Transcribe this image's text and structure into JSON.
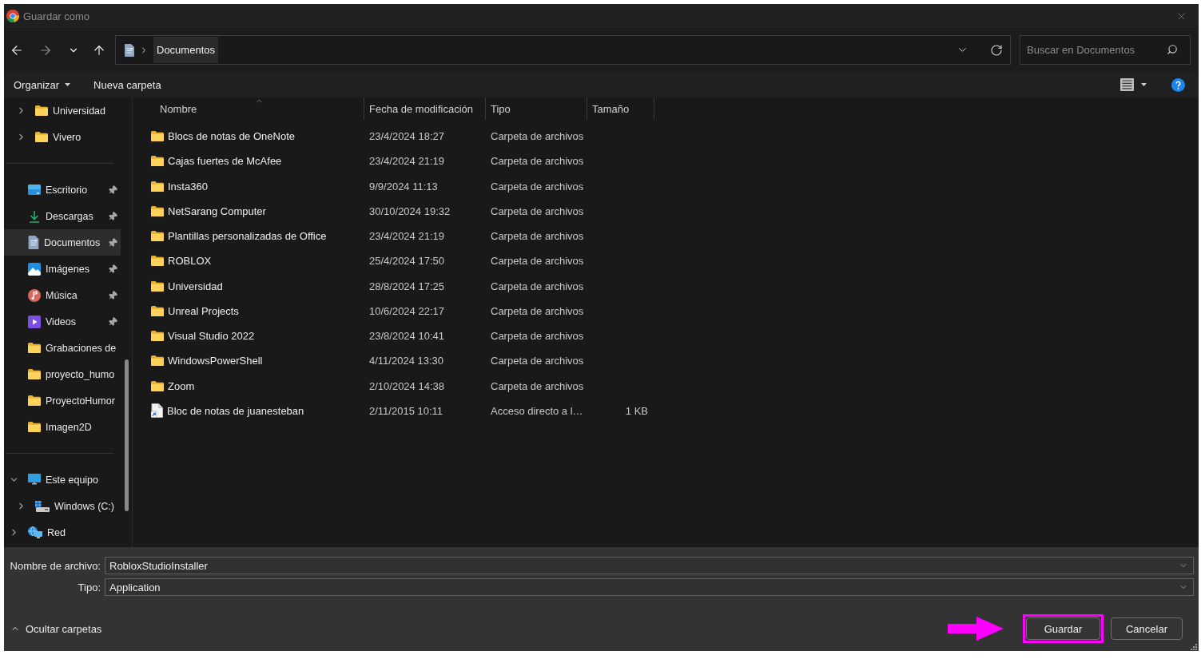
{
  "window": {
    "title": "Guardar como"
  },
  "navigation": {
    "buttons": [
      {
        "kind": "back",
        "disabled": false
      },
      {
        "kind": "forward",
        "disabled": true
      },
      {
        "kind": "recent",
        "disabled": false
      },
      {
        "kind": "up",
        "disabled": false
      }
    ],
    "address": {
      "path": [
        "Documentos"
      ]
    },
    "search": {
      "placeholder": "Buscar en Documentos"
    }
  },
  "toolbar": {
    "items": [
      {
        "label": "Organizar",
        "kind": "menu"
      },
      {
        "label": "Nueva carpeta",
        "kind": "button"
      }
    ]
  },
  "sidebar": {
    "sections": [
      {
        "kind": "nested",
        "items": [
          {
            "label": "Universidad",
            "kind": "folder",
            "expanded": false,
            "selected": false
          },
          {
            "label": "Vivero",
            "kind": "folder",
            "expanded": false,
            "selected": false
          }
        ]
      },
      {
        "kind": "quick_access",
        "items": [
          {
            "label": "Escritorio",
            "kind": "desktop",
            "pinned": true,
            "selected": false
          },
          {
            "label": "Descargas",
            "kind": "download",
            "pinned": true,
            "selected": false
          },
          {
            "label": "Documentos",
            "kind": "documents",
            "pinned": true,
            "selected": true
          },
          {
            "label": "Imágenes",
            "kind": "pictures",
            "pinned": true,
            "selected": false
          },
          {
            "label": "Música",
            "kind": "music",
            "pinned": true,
            "selected": false
          },
          {
            "label": "Videos",
            "kind": "videos",
            "pinned": true,
            "selected": false
          },
          {
            "label": "Grabaciones de",
            "kind": "folder",
            "pinned": false,
            "selected": false
          },
          {
            "label": "proyecto_humo",
            "kind": "folder",
            "pinned": false,
            "selected": false
          },
          {
            "label": "ProyectoHumor",
            "kind": "folder",
            "pinned": false,
            "selected": false
          },
          {
            "label": "Imagen2D",
            "kind": "folder",
            "pinned": false,
            "selected": false
          }
        ]
      },
      {
        "kind": "tree",
        "items": [
          {
            "label": "Este equipo",
            "kind": "computer",
            "expanded": true,
            "selected": false,
            "children": [
              {
                "label": "Windows (C:)",
                "kind": "drive",
                "expanded": false,
                "selected": false
              }
            ]
          },
          {
            "label": "Red",
            "kind": "network",
            "expanded": false,
            "selected": false
          }
        ]
      }
    ]
  },
  "file_list": {
    "columns": [
      {
        "label": "Nombre",
        "sorted": true
      },
      {
        "label": "Fecha de modificación",
        "sorted": false
      },
      {
        "label": "Tipo",
        "sorted": false
      },
      {
        "label": "Tamaño",
        "sorted": false
      }
    ],
    "rows": [
      {
        "kind": "folder",
        "name": "Blocs de notas de OneNote",
        "date": "23/4/2024 18:27",
        "type": "Carpeta de archivos",
        "selected": false
      },
      {
        "kind": "folder",
        "name": "Cajas fuertes de McAfee",
        "date": "23/4/2024 21:19",
        "type": "Carpeta de archivos",
        "selected": false
      },
      {
        "kind": "folder",
        "name": "Insta360",
        "date": "9/9/2024 11:13",
        "type": "Carpeta de archivos",
        "selected": false
      },
      {
        "kind": "folder",
        "name": "NetSarang Computer",
        "date": "30/10/2024 19:32",
        "type": "Carpeta de archivos",
        "selected": false
      },
      {
        "kind": "folder",
        "name": "Plantillas personalizadas de Office",
        "date": "23/4/2024 21:19",
        "type": "Carpeta de archivos",
        "selected": false
      },
      {
        "kind": "folder",
        "name": "ROBLOX",
        "date": "25/4/2024 17:50",
        "type": "Carpeta de archivos",
        "selected": false
      },
      {
        "kind": "folder",
        "name": "Universidad",
        "date": "28/8/2024 17:25",
        "type": "Carpeta de archivos",
        "selected": false
      },
      {
        "kind": "folder",
        "name": "Unreal Projects",
        "date": "10/6/2024 22:17",
        "type": "Carpeta de archivos",
        "selected": false
      },
      {
        "kind": "folder",
        "name": "Visual Studio 2022",
        "date": "23/8/2024 10:41",
        "type": "Carpeta de archivos",
        "selected": false
      },
      {
        "kind": "folder",
        "name": "WindowsPowerShell",
        "date": "4/11/2024 13:30",
        "type": "Carpeta de archivos",
        "selected": false
      },
      {
        "kind": "folder",
        "name": "Zoom",
        "date": "2/10/2024 14:38",
        "type": "Carpeta de archivos",
        "selected": false
      },
      {
        "kind": "shortcut",
        "name": "Bloc de notas de juanesteban",
        "date": "2/11/2015 10:11",
        "type": "Acceso directo a l…",
        "size": "1 KB",
        "selected": false
      }
    ]
  },
  "save_form": {
    "fields": [
      {
        "label": "Nombre de archivo:",
        "value": "RobloxStudioInstaller"
      },
      {
        "label": "Tipo:",
        "value": "Application"
      }
    ],
    "folders_toggle": {
      "label": "Ocultar carpetas",
      "expanded": true
    },
    "buttons": [
      {
        "label": "Guardar",
        "highlighted": true
      },
      {
        "label": "Cancelar",
        "highlighted": false
      }
    ]
  }
}
